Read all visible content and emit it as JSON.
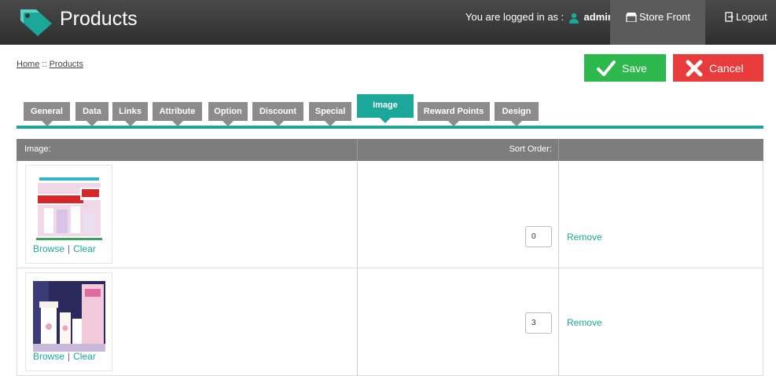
{
  "header": {
    "title": "Products",
    "logged_in_label": "You are logged in as :",
    "username": "admin",
    "storefront_label": "Store Front",
    "logout_label": "Logout"
  },
  "breadcrumb": {
    "home": "Home",
    "separator": " :: ",
    "current": "Products"
  },
  "actions": {
    "save_label": "Save",
    "cancel_label": "Cancel"
  },
  "tabs": [
    {
      "label": "General"
    },
    {
      "label": "Data"
    },
    {
      "label": "Links"
    },
    {
      "label": "Attribute"
    },
    {
      "label": "Option"
    },
    {
      "label": "Discount"
    },
    {
      "label": "Special"
    },
    {
      "label": "Image",
      "active": true
    },
    {
      "label": "Reward Points"
    },
    {
      "label": "Design"
    }
  ],
  "table": {
    "col_image": "Image:",
    "col_sort": "Sort Order:",
    "rows": [
      {
        "browse": "Browse",
        "sep": "|",
        "clear": "Clear",
        "sort_order": "0",
        "remove": "Remove"
      },
      {
        "browse": "Browse",
        "sep": "|",
        "clear": "Clear",
        "sort_order": "3",
        "remove": "Remove"
      }
    ]
  },
  "colors": {
    "accent": "#1ba79a",
    "header_bg": "#3a3a3a",
    "save": "#2db84d",
    "cancel": "#e83b3b",
    "tab_inactive": "#8c8c8c"
  }
}
